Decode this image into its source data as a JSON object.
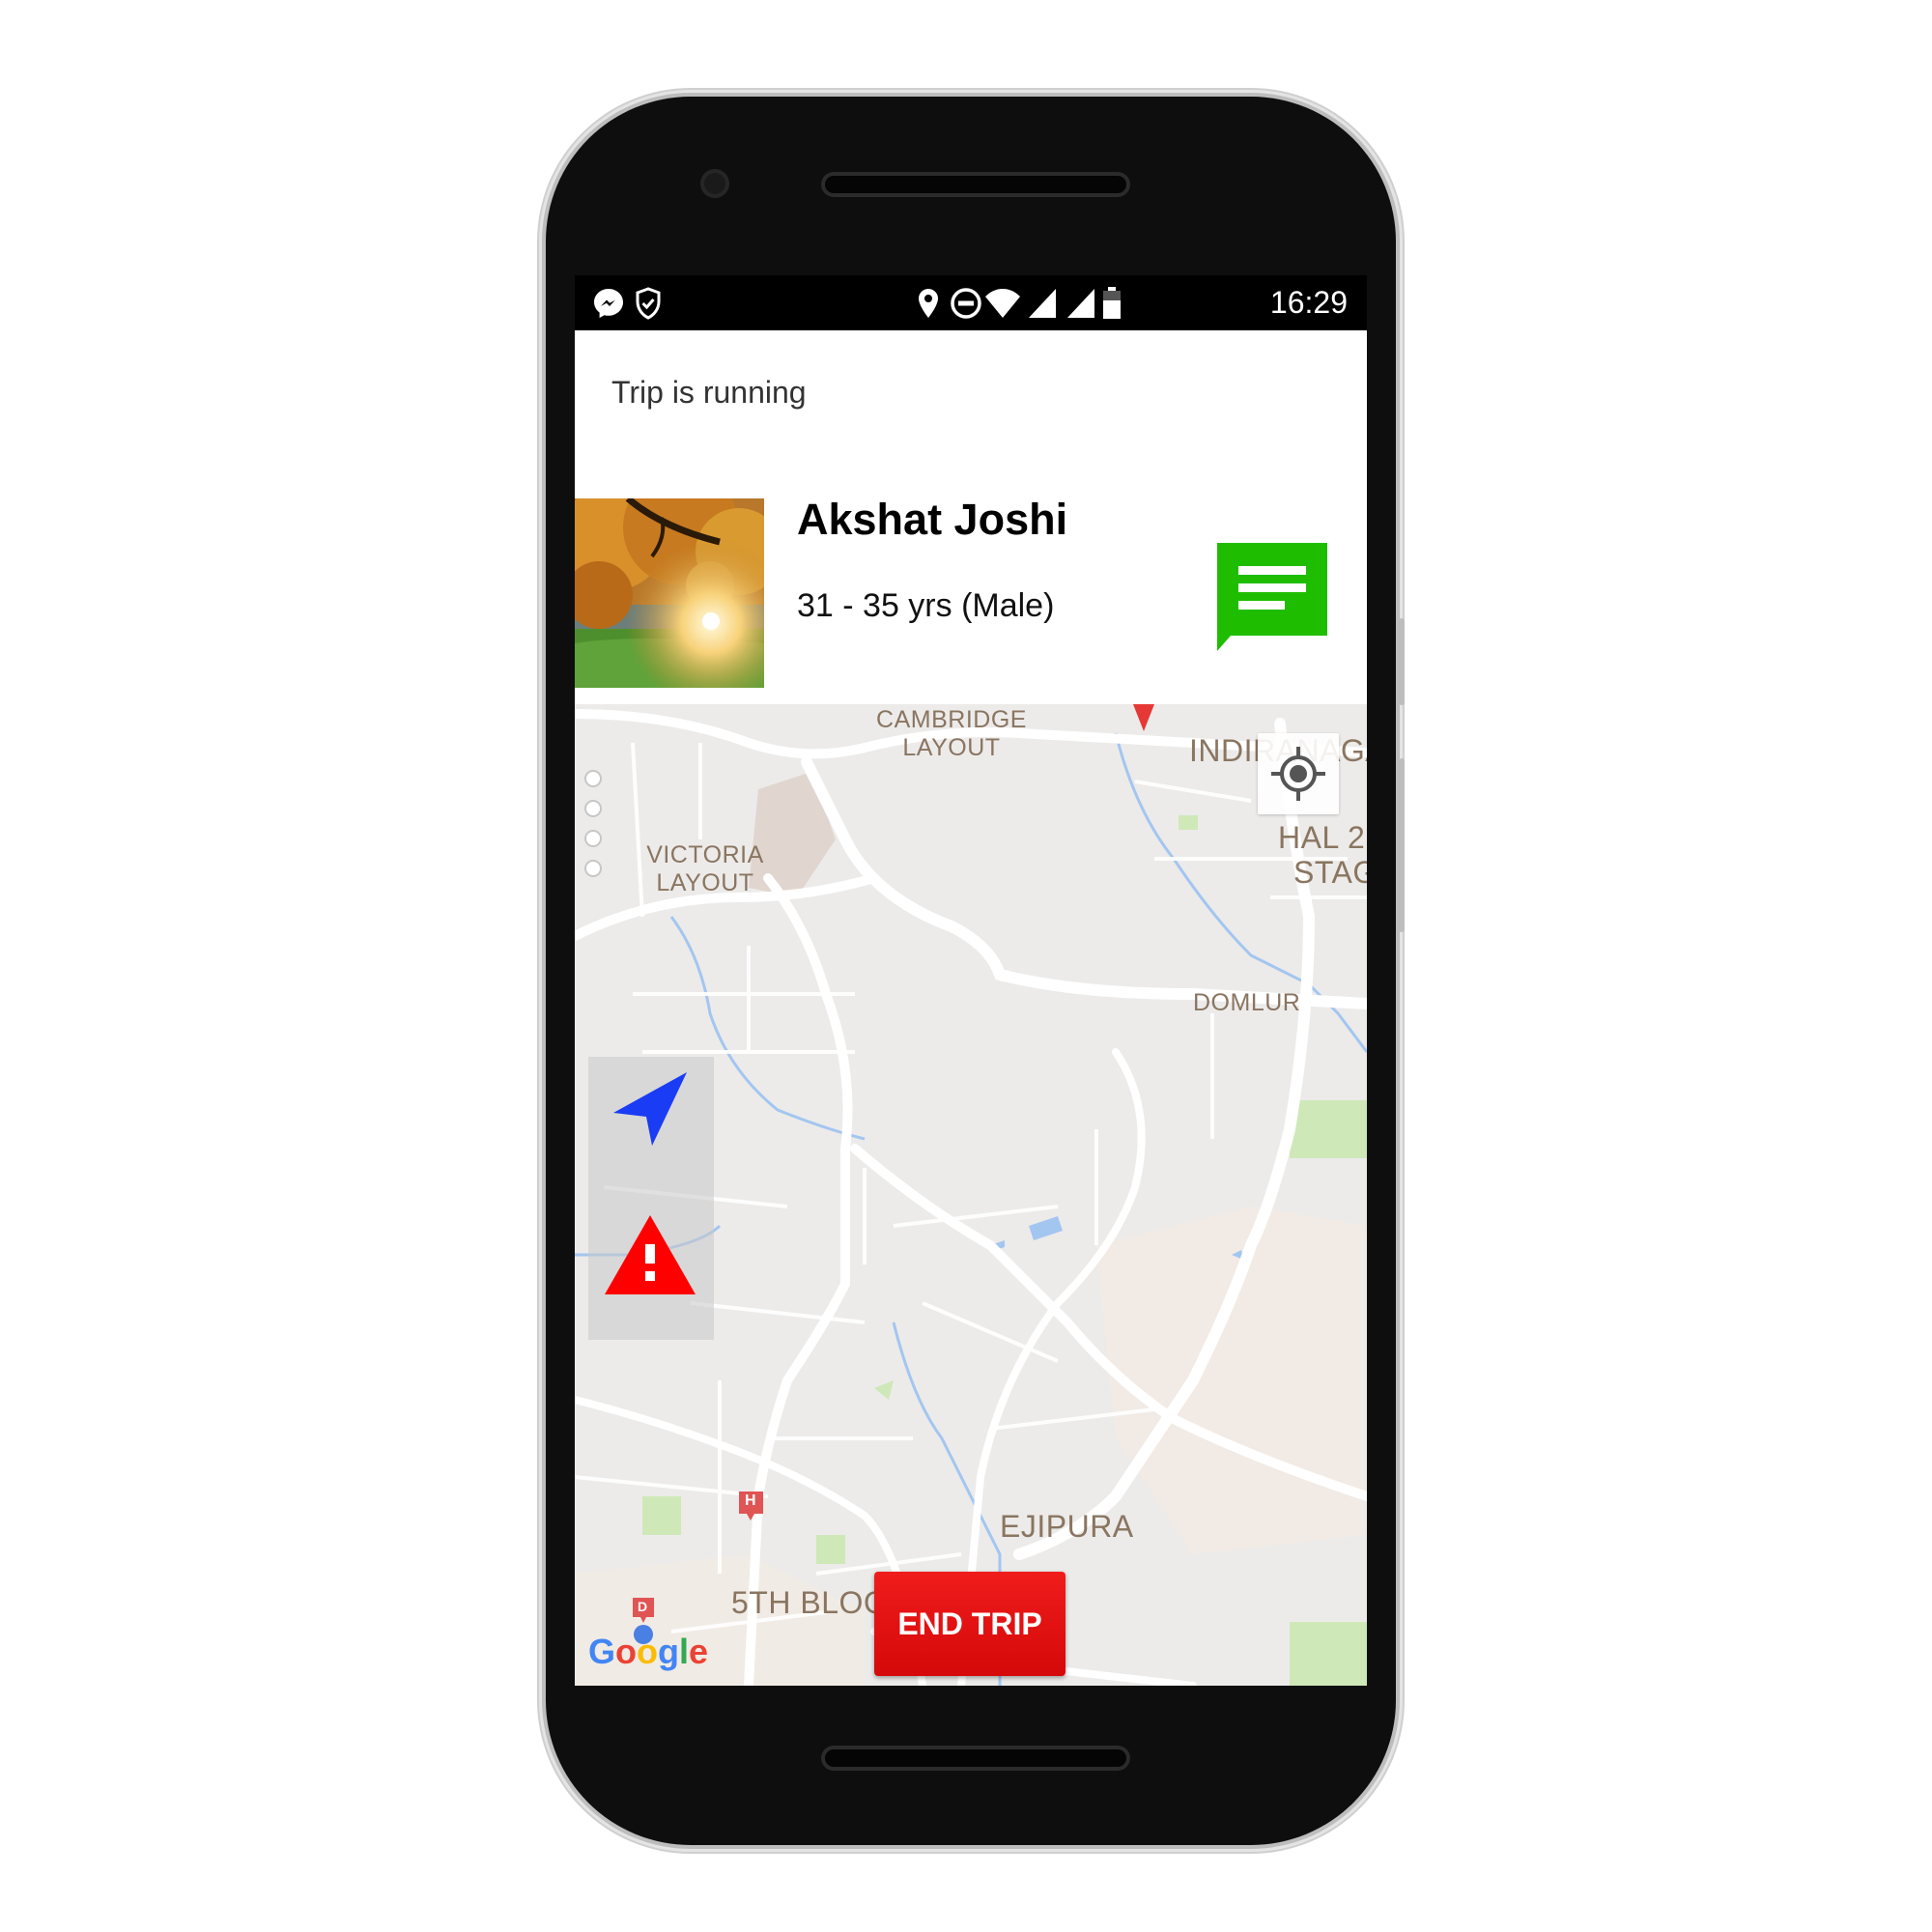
{
  "status_bar": {
    "time": "16:29",
    "left_icons": [
      "messenger-icon",
      "shield-check-icon"
    ],
    "right_icons": [
      "location-pin-icon",
      "do-not-disturb-icon",
      "wifi-icon",
      "signal-icon",
      "signal-icon",
      "battery-icon"
    ]
  },
  "header": {
    "title": "Trip is running"
  },
  "profile": {
    "name": "Akshat Joshi",
    "details": "31 - 35 yrs (Male)",
    "photo": "autumn-tree-landscape",
    "message_icon": "chat-message-icon"
  },
  "map": {
    "labels": {
      "cambridge_l1": "CAMBRIDGE",
      "cambridge_l2": "LAYOUT",
      "victoria_l1": "VICTORIA",
      "victoria_l2": "LAYOUT",
      "indiranagar": "INDIRANAGA",
      "hal_l1": "HAL 2",
      "hal_l2": "STAG",
      "domlur": "DOMLUR",
      "ejipura": "EJIPURA",
      "fifth_block": "5TH BLOC"
    },
    "marker_h": "H",
    "marker_d": "D",
    "attribution": "Google"
  },
  "controls": {
    "navigate_icon": "navigation-arrow-icon",
    "alert_icon": "warning-icon",
    "locate_icon": "my-location-icon",
    "end_trip_label": "END TRIP"
  },
  "colors": {
    "accent_green": "#1fbd00",
    "end_trip_red": "#e31010",
    "nav_blue": "#1a3cf5",
    "alert_red": "#ff0000"
  }
}
